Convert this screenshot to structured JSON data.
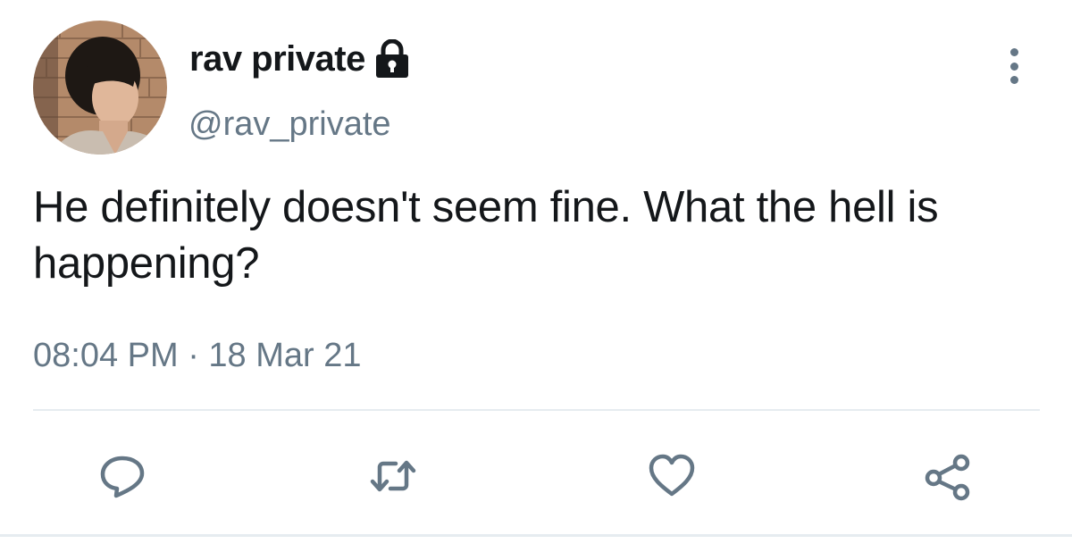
{
  "user": {
    "display_name": "rav private",
    "handle": "@rav_private",
    "protected_icon": "lock-icon",
    "avatar": "profile-photo"
  },
  "tweet": {
    "text": "He definitely doesn't seem fine. What the hell is happening?",
    "timestamp": "08:04 PM · 18 Mar 21"
  },
  "actions": [
    "reply-icon",
    "retweet-icon",
    "like-icon",
    "share-icon"
  ],
  "menu_icon": "more-vertical-icon",
  "colors": {
    "primary_text": "#14171a",
    "secondary_text": "#657786",
    "divider": "#e6ecf0"
  }
}
